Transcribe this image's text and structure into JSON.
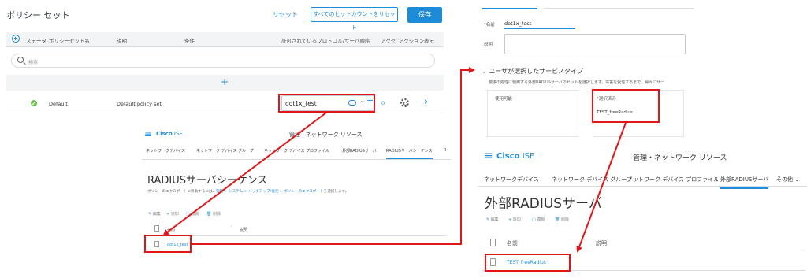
{
  "policy_sets": {
    "title": "ポリシー セット",
    "reset_label": "リセット",
    "reset_all_label": "すべてのヒットカウントをリセット",
    "save_label": "保存",
    "columns": {
      "status": "ステータ",
      "name": "ポリシーセット名",
      "description": "説明",
      "conditions": "条件",
      "allowed_protocols": "許可されているプロトコル/サーバ順序",
      "hits": "アクセ",
      "actions": "アクション",
      "view": "表示"
    },
    "search_placeholder": "検索",
    "add_row_symbol": "+",
    "row": {
      "name": "Default",
      "description": "Default policy set",
      "protocol_value": "dot1x_test",
      "hits": "0",
      "status_color": "#6cc04a"
    }
  },
  "detail": {
    "name_label": "*名前",
    "name_value": "dot1x_test",
    "desc_label": "説明",
    "section_title": "ユーザが選択したサービスタイプ",
    "section_desc": "要求の処理に使用する外部RADIUSサーバのセットを選択します。応答を受信するまで、繰々にサー",
    "available_label": "使用可能",
    "selected_label": "*選択済み",
    "selected_item": "TEST_freeRadius"
  },
  "ise_middle": {
    "logo": "Cisco",
    "logo_suffix": "ISE",
    "page_header": "管理 · ネットワーク リソース",
    "tabs": [
      "ネットワークデバイス",
      "ネットワーク デバイス グループ",
      "ネットワーク デバイス プロファイル",
      "外部RADIUSサーバ",
      "RADIUSサーバシーケンス",
      "R"
    ],
    "active_tab": 4,
    "title": "RADIUSサーバシーケンス",
    "desc_prefix": "ポリシーのエクスポートに移動するには、",
    "desc_link1": "管理 > システム > バックアップ/復元 > ポリシーのエクスポート",
    "desc_suffix": "を選択します。",
    "toolbar": [
      "編集",
      "追加",
      "複製",
      "削除"
    ],
    "col_name": "名前",
    "col_desc": "説明",
    "row_name": "dot1x_test"
  },
  "ise_bottom": {
    "logo": "Cisco",
    "logo_suffix": "ISE",
    "page_header": "管理・ネットワーク リソース",
    "tabs": [
      "ネットワークデバイス",
      "ネットワーク デバイス グループ",
      "ネットワーク デバイス プロファイル",
      "外部RADIUSサーバ",
      "その他"
    ],
    "active_tab": 3,
    "title": "外部RADIUSサーバ",
    "toolbar": [
      "編集",
      "追加",
      "複製",
      "削除"
    ],
    "col_name": "名前",
    "col_desc": "説明",
    "row_name": "TEST_freeRadius"
  },
  "colors": {
    "accent": "#1e8bd6",
    "highlight": "#e0161b"
  }
}
